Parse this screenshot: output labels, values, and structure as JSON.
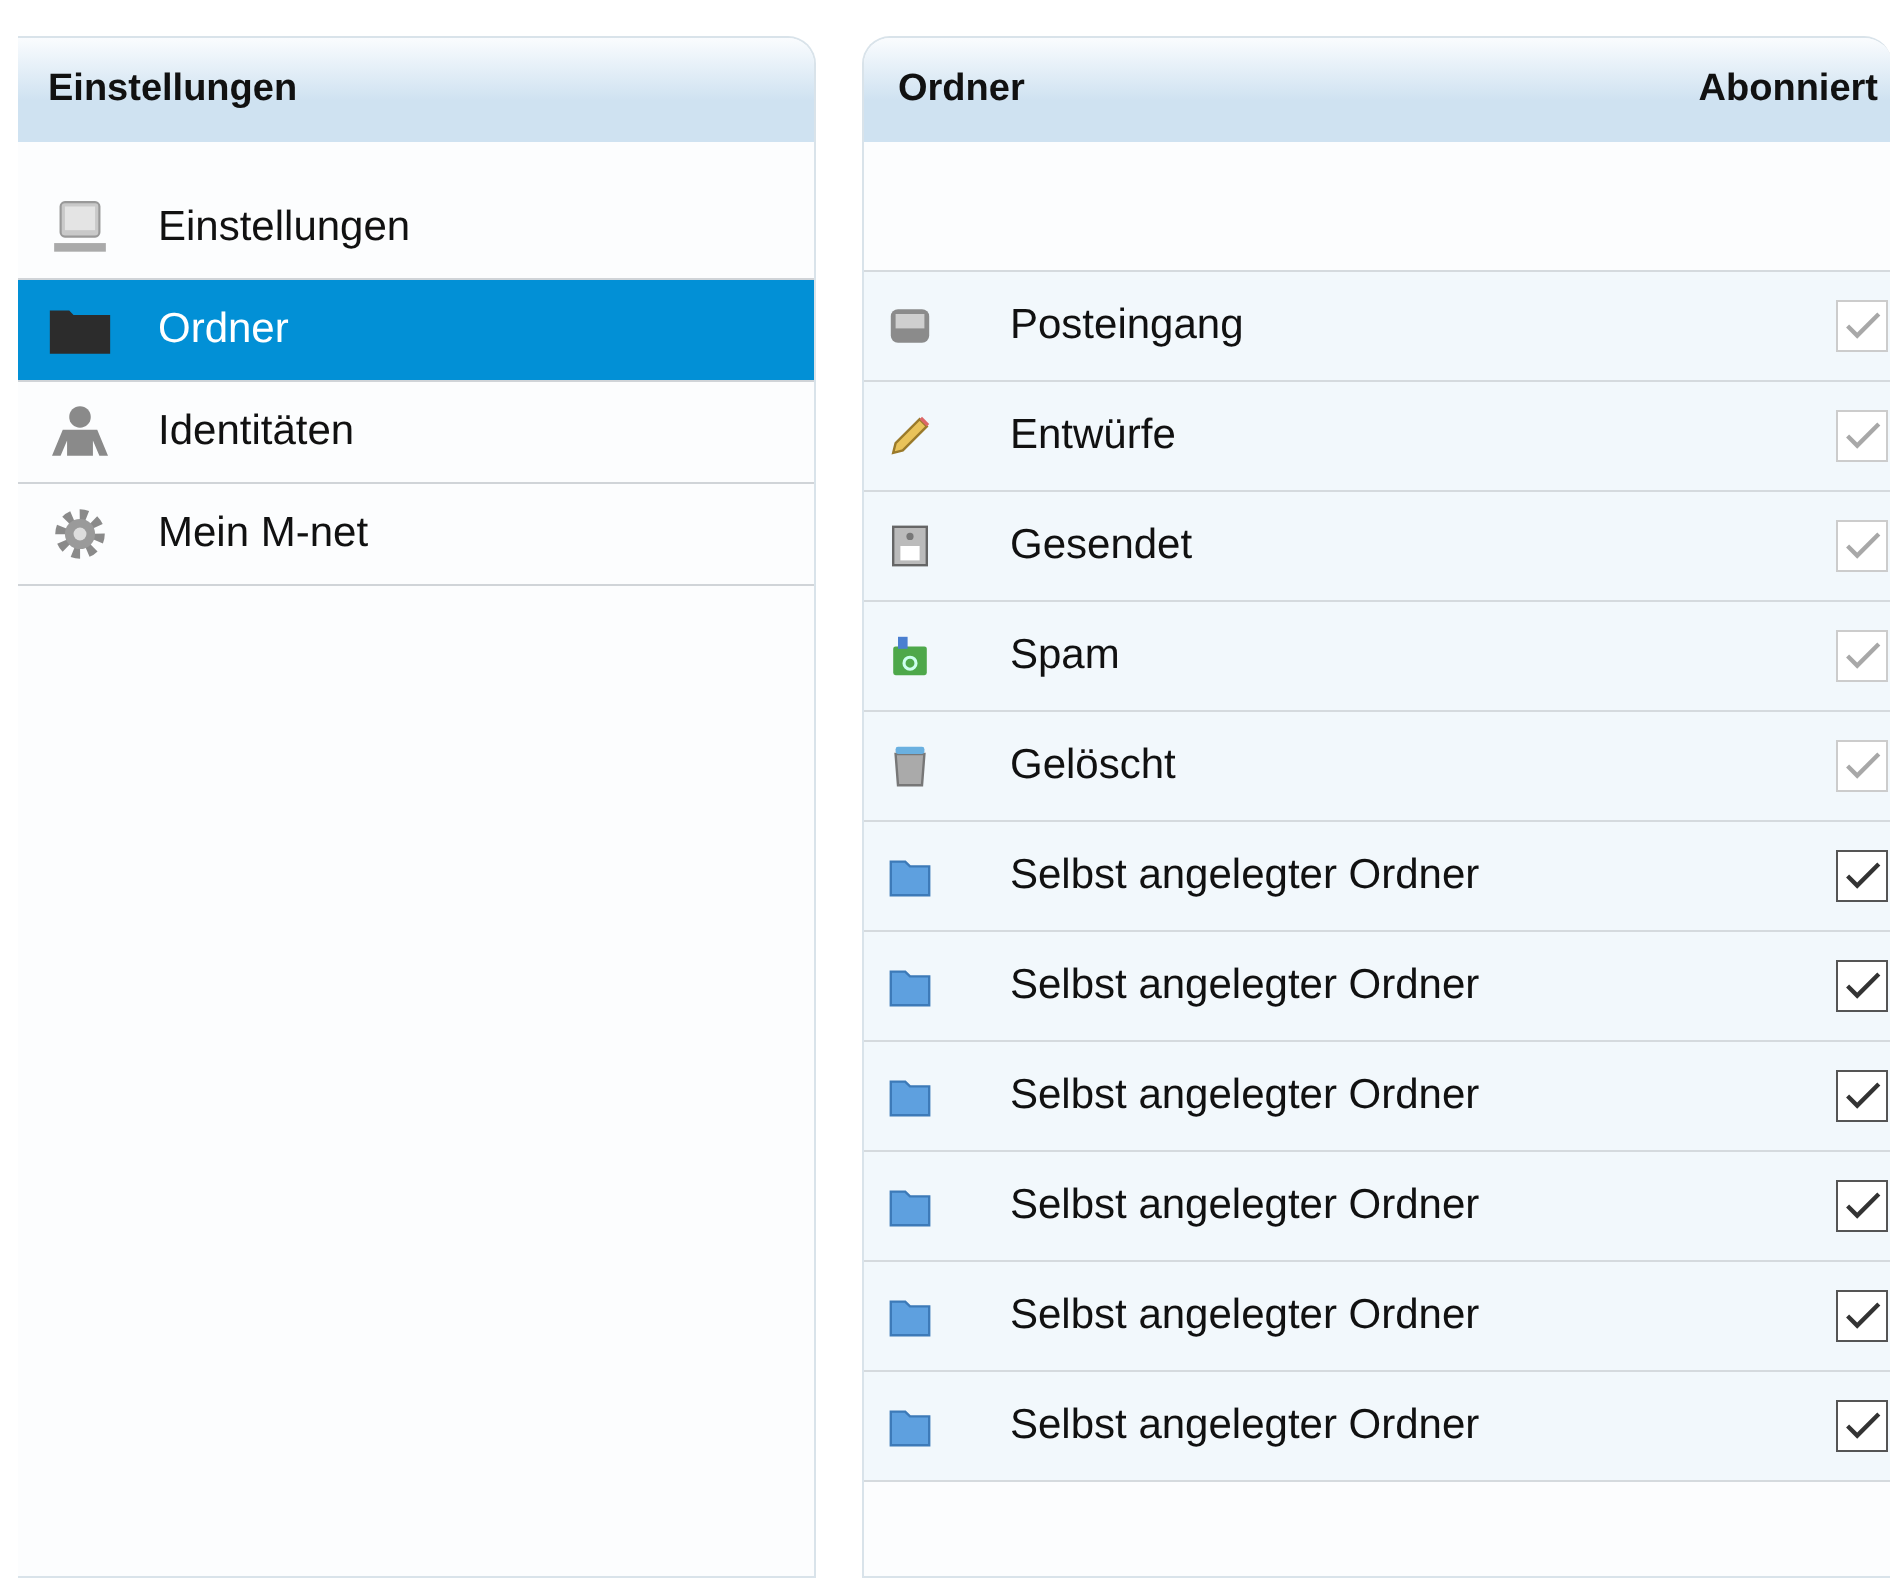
{
  "sidebar": {
    "title": "Einstellungen",
    "items": [
      {
        "label": "Einstellungen",
        "kind": "computer",
        "selected": false
      },
      {
        "label": "Ordner",
        "kind": "folder",
        "selected": true
      },
      {
        "label": "Identitäten",
        "kind": "person",
        "selected": false
      },
      {
        "label": "Mein M-net",
        "kind": "gear",
        "selected": false
      }
    ]
  },
  "folders": {
    "columns": [
      "Ordner",
      "Abonniert"
    ],
    "rows": [
      {
        "name": "Posteingang",
        "kind": "inbox",
        "checked": true,
        "disabled": true
      },
      {
        "name": "Entwürfe",
        "kind": "drafts",
        "checked": true,
        "disabled": true
      },
      {
        "name": "Gesendet",
        "kind": "sent",
        "checked": true,
        "disabled": true
      },
      {
        "name": "Spam",
        "kind": "spam",
        "checked": true,
        "disabled": true
      },
      {
        "name": "Gelöscht",
        "kind": "trash",
        "checked": true,
        "disabled": true
      },
      {
        "name": "Selbst angelegter Ordner",
        "kind": "folder",
        "checked": true,
        "disabled": false
      },
      {
        "name": "Selbst angelegter Ordner",
        "kind": "folder",
        "checked": true,
        "disabled": false
      },
      {
        "name": "Selbst angelegter Ordner",
        "kind": "folder",
        "checked": true,
        "disabled": false
      },
      {
        "name": "Selbst angelegter Ordner",
        "kind": "folder",
        "checked": true,
        "disabled": false
      },
      {
        "name": "Selbst angelegter Ordner",
        "kind": "folder",
        "checked": true,
        "disabled": false
      },
      {
        "name": "Selbst angelegter Ordner",
        "kind": "folder",
        "checked": true,
        "disabled": false
      }
    ]
  }
}
